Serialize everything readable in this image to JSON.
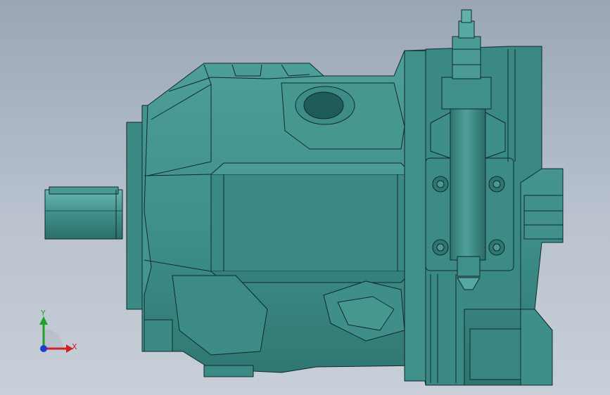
{
  "viewport": {
    "name": "cad-graphics-area",
    "colors": {
      "bg_top": "#9aa6b6",
      "bg_bottom": "#c8cfd8",
      "body": "#3e8f8b",
      "body_dark": "#2f7571",
      "body_light": "#56a9a3",
      "edge": "#0f2a2a"
    }
  },
  "triad": {
    "y_label": "Y",
    "x_label": "X",
    "colors": {
      "x": "#d22020",
      "y": "#21a32a",
      "z": "#1c3fd0"
    }
  }
}
